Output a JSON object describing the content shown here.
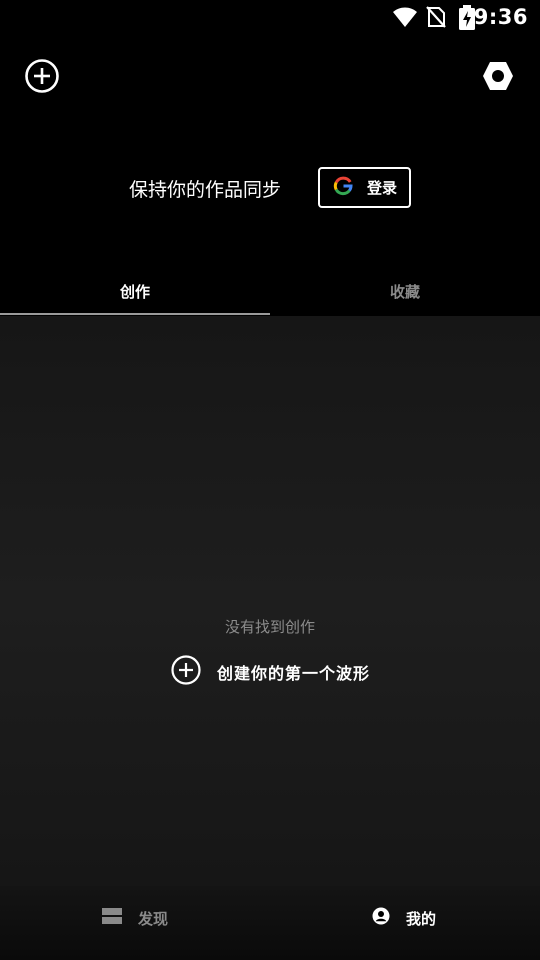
{
  "status_bar": {
    "time": "9:36",
    "icons": [
      "wifi-icon",
      "no-sim-icon",
      "battery-charging-icon"
    ]
  },
  "header": {
    "add_icon": "plus-circle-icon",
    "settings_icon": "hexagon-settings-icon",
    "sync_text": "保持你的作品同步",
    "login_button": {
      "icon": "google-logo-icon",
      "label": "登录"
    }
  },
  "tabs": [
    {
      "label": "创作",
      "active": true
    },
    {
      "label": "收藏",
      "active": false
    }
  ],
  "content": {
    "empty_text": "没有找到创作",
    "create_cta_label": "创建你的第一个波形",
    "create_cta_icon": "plus-circle-icon"
  },
  "bottom_nav": [
    {
      "label": "发现",
      "icon": "discover-icon",
      "active": false
    },
    {
      "label": "我的",
      "icon": "profile-icon",
      "active": true
    }
  ],
  "colors": {
    "background": "#000000",
    "content_background": "#1e1e1e",
    "text_primary": "#ffffff",
    "text_muted": "#8a8a8a",
    "google_blue": "#4285F4",
    "google_red": "#EA4335",
    "google_yellow": "#FBBC05",
    "google_green": "#34A853"
  }
}
